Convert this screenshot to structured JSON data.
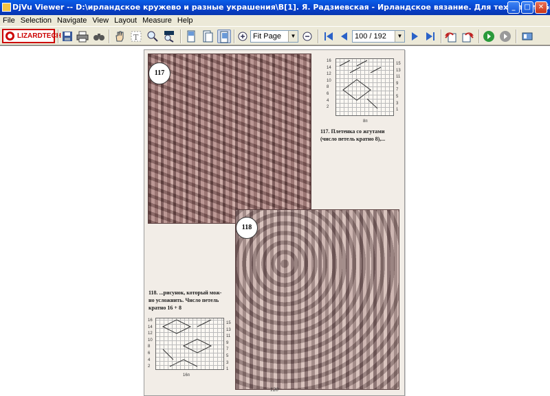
{
  "window": {
    "title": "DjVu Viewer -- D:\\ирландское кружево и разные украшения\\В[1]. Я. Радзиевская - Ирландское вязание. Для тех, кто любит вязать.djvu",
    "min_label": "_",
    "max_label": "□",
    "close_label": "✕"
  },
  "menu": [
    "File",
    "Selection",
    "Navigate",
    "View",
    "Layout",
    "Measure",
    "Help"
  ],
  "toolbar": {
    "logo": "LIZARDTECH",
    "zoom_value": "Fit Page",
    "page_value": "100 / 192",
    "icons": [
      "save-icon",
      "print-icon",
      "binoculars-icon",
      "hand-icon",
      "text-select-icon",
      "zoom-tool-icon",
      "region-icon",
      "single-page-icon",
      "continuous-icon",
      "facing-pages-icon",
      "zoom-in-icon",
      "zoom-out-icon",
      "first-page-icon",
      "prev-page-icon",
      "next-page-icon",
      "last-page-icon",
      "back-icon",
      "forward-icon",
      "go-green-icon",
      "go-gray-icon",
      "thumbnails-icon"
    ]
  },
  "document": {
    "badge_117": "117",
    "badge_118": "118",
    "caption_117": [
      "117. Плетенка со жгутами",
      "(число петель кратно 8),..."
    ],
    "caption_118": [
      "118. ...рисунок, который мож-",
      "но усложнить. Число петель",
      "кратно 16 + 8"
    ],
    "chart1_left": [
      "16",
      "14",
      "12",
      "10",
      "8",
      "6",
      "4",
      "2"
    ],
    "chart1_right": [
      "15",
      "13",
      "11",
      "9",
      "7",
      "5",
      "3",
      "1"
    ],
    "chart2_left": [
      "16",
      "14",
      "12",
      "10",
      "8",
      "6",
      "4",
      "2"
    ],
    "chart2_right": [
      "15",
      "13",
      "11",
      "9",
      "7",
      "5",
      "3",
      "1"
    ],
    "chart1_repeat": "8п",
    "chart2_repeat": "16п",
    "page_number": "120"
  }
}
